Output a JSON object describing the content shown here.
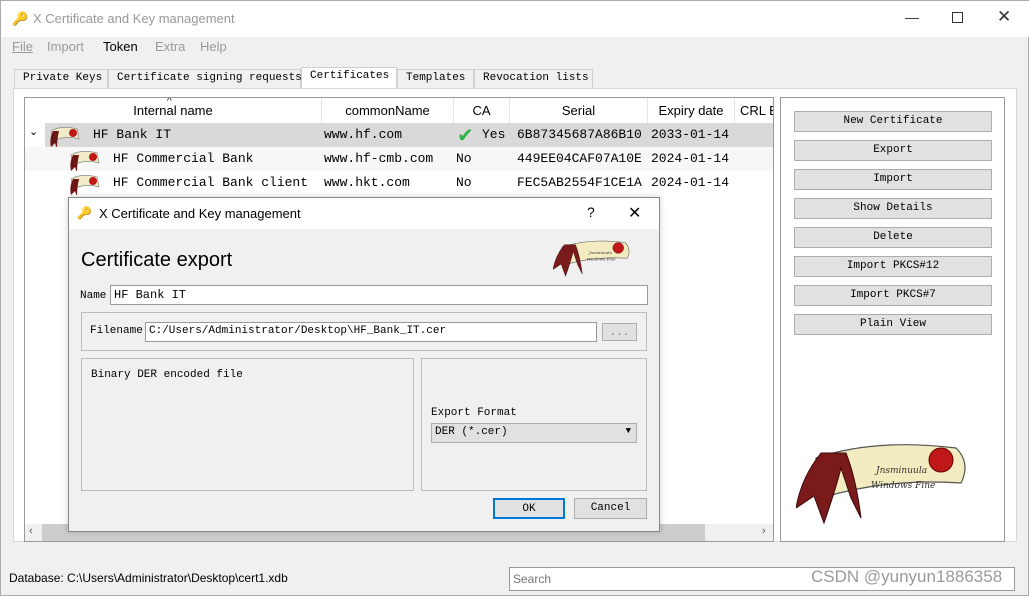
{
  "window": {
    "title": "X Certificate and Key management"
  },
  "menu": [
    "File",
    "Import",
    "Token",
    "Extra",
    "Help"
  ],
  "tabs": [
    "Private Keys",
    "Certificate signing requests",
    "Certificates",
    "Templates",
    "Revocation lists"
  ],
  "active_tab": "Certificates",
  "table": {
    "columns": [
      "Internal name",
      "commonName",
      "CA",
      "Serial",
      "Expiry date",
      "CRL E"
    ],
    "rows": [
      {
        "name": "HF Bank IT",
        "cn": "www.hf.com",
        "ca": "Yes",
        "serial": "6B87345687A86B10",
        "expiry": "2033-01-14",
        "level": 0,
        "expanded": true,
        "selected": true
      },
      {
        "name": "HF Commercial Bank",
        "cn": "www.hf-cmb.com",
        "ca": "No",
        "serial": "449EE04CAF07A10E",
        "expiry": "2024-01-14",
        "level": 1
      },
      {
        "name": "HF Commercial Bank client",
        "cn": "www.hkt.com",
        "ca": "No",
        "serial": "FEC5AB2554F1CE1A",
        "expiry": "2024-01-14",
        "level": 1
      }
    ]
  },
  "side_buttons": [
    "New Certificate",
    "Export",
    "Import",
    "Show Details",
    "Delete",
    "Import PKCS#12",
    "Import PKCS#7",
    "Plain View"
  ],
  "dialog": {
    "title": "X Certificate and Key management",
    "help": "?",
    "heading": "Certificate export",
    "name_label": "Name",
    "name_value": "HF Bank IT",
    "filename_label": "Filename",
    "filename_value": "C:/Users/Administrator/Desktop\\HF_Bank_IT.cer",
    "browse": "...",
    "description": "Binary DER encoded file",
    "format_label": "Export Format",
    "format_value": "DER (*.cer)",
    "ok": "OK",
    "cancel": "Cancel"
  },
  "status": {
    "database": "Database: C:\\Users\\Administrator\\Desktop\\cert1.xdb",
    "search_placeholder": "Search"
  },
  "watermark": "CSDN @yunyun1886358",
  "colors": {
    "selected_row": "#d9d9d9",
    "ok_border": "#0078d7",
    "check": "#2bb34a",
    "ribbon": "#7a1a1a"
  }
}
